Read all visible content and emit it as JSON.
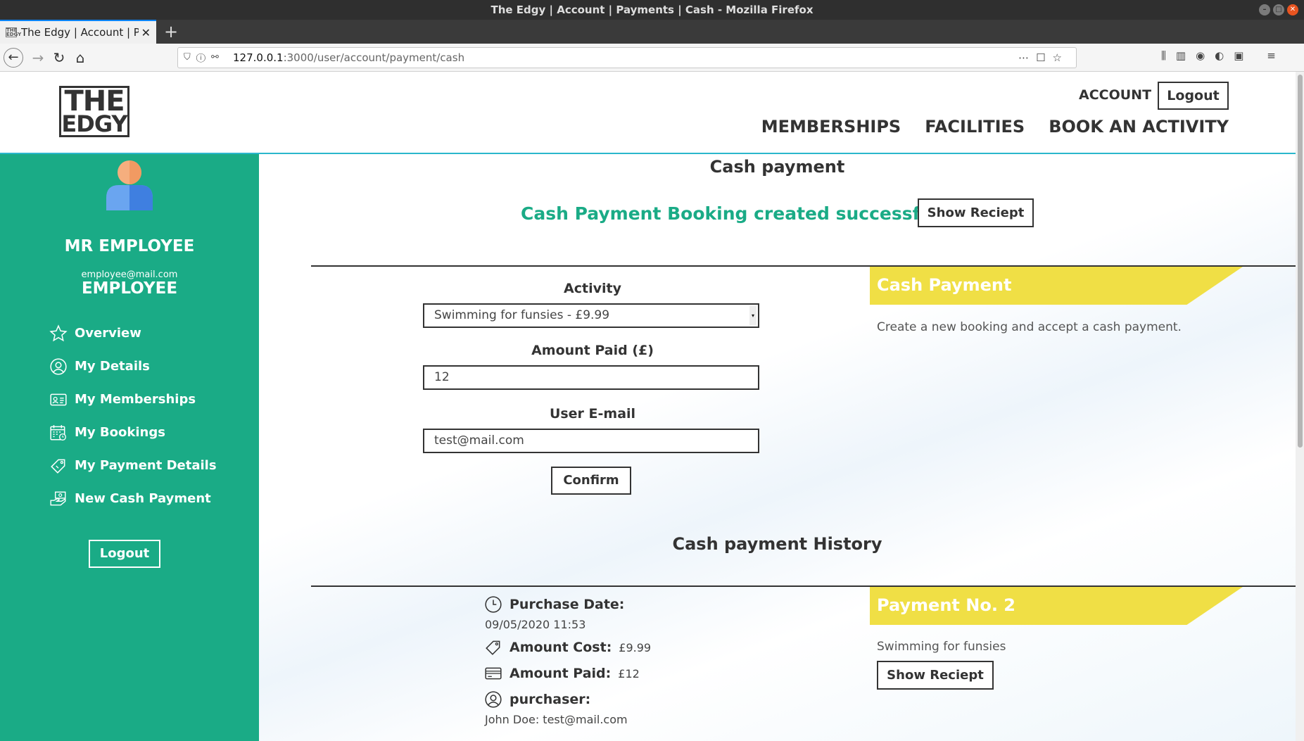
{
  "window": {
    "title": "The Edgy | Account | Payments | Cash - Mozilla Firefox"
  },
  "browser": {
    "tab_title": "The Edgy | Account | Pay",
    "tab_favicon": "THE EDGY",
    "url_host": "127.0.0.1",
    "url_path": ":3000/user/account/payment/cash"
  },
  "header": {
    "logo_line1": "THE",
    "logo_line2": "EDGY",
    "account": "ACCOUNT",
    "logout": "Logout",
    "nav": [
      "MEMBERSHIPS",
      "FACILITIES",
      "BOOK AN ACTIVITY"
    ]
  },
  "sidebar": {
    "name": "MR EMPLOYEE",
    "email": "employee@mail.com",
    "role": "EMPLOYEE",
    "items": [
      {
        "label": "Overview",
        "icon": "star-icon"
      },
      {
        "label": "My Details",
        "icon": "user-circle-icon"
      },
      {
        "label": "My Memberships",
        "icon": "id-card-icon"
      },
      {
        "label": "My Bookings",
        "icon": "calendar-icon"
      },
      {
        "label": "My Payment Details",
        "icon": "price-tag-icon"
      },
      {
        "label": "New Cash Payment",
        "icon": "cash-icon"
      }
    ],
    "logout": "Logout"
  },
  "main": {
    "title": "Cash payment",
    "success_message": "Cash Payment Booking created successfully",
    "show_receipt": "Show Reciept",
    "form": {
      "activity_label": "Activity",
      "activity_value": "Swimming for funsies - £9.99",
      "amount_label": "Amount Paid (£)",
      "amount_value": "12",
      "email_label": "User E-mail",
      "email_value": "test@mail.com",
      "confirm": "Confirm"
    },
    "info": {
      "banner": "Cash Payment",
      "description": "Create a new booking and accept a cash payment."
    },
    "history": {
      "title": "Cash payment History",
      "purchase_date_label": "Purchase Date:",
      "purchase_date": "09/05/2020 11:53",
      "amount_cost_label": "Amount Cost:",
      "amount_cost": "£9.99",
      "amount_paid_label": "Amount Paid:",
      "amount_paid": "£12",
      "purchaser_label": "purchaser:",
      "purchaser": "John Doe: test@mail.com",
      "payment_banner": "Payment No. 2",
      "payment_activity": "Swimming for funsies",
      "show_receipt": "Show Reciept"
    }
  },
  "colors": {
    "accent": "#1aab86",
    "banner": "#f0df45",
    "header_rule": "#2bb7cc",
    "avatar_head": "#f5ae7e",
    "avatar_body": "#4f8fe8"
  }
}
